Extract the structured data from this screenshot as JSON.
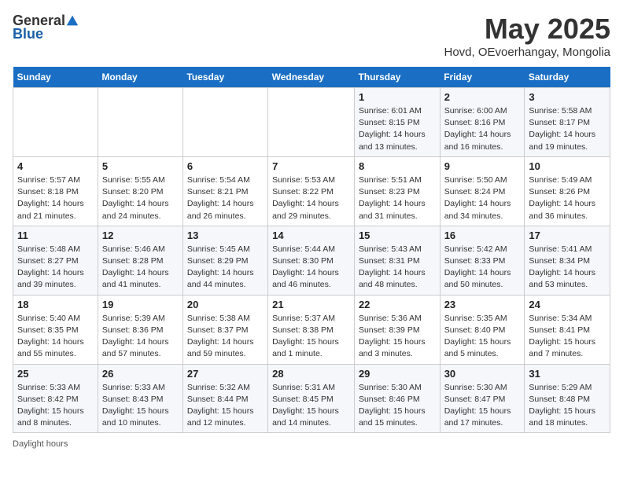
{
  "logo": {
    "general": "General",
    "blue": "Blue"
  },
  "title": {
    "month": "May 2025",
    "location": "Hovd, OEvoerhangay, Mongolia"
  },
  "weekdays": [
    "Sunday",
    "Monday",
    "Tuesday",
    "Wednesday",
    "Thursday",
    "Friday",
    "Saturday"
  ],
  "weeks": [
    [
      {
        "day": "",
        "info": ""
      },
      {
        "day": "",
        "info": ""
      },
      {
        "day": "",
        "info": ""
      },
      {
        "day": "",
        "info": ""
      },
      {
        "day": "1",
        "info": "Sunrise: 6:01 AM\nSunset: 8:15 PM\nDaylight: 14 hours\nand 13 minutes."
      },
      {
        "day": "2",
        "info": "Sunrise: 6:00 AM\nSunset: 8:16 PM\nDaylight: 14 hours\nand 16 minutes."
      },
      {
        "day": "3",
        "info": "Sunrise: 5:58 AM\nSunset: 8:17 PM\nDaylight: 14 hours\nand 19 minutes."
      }
    ],
    [
      {
        "day": "4",
        "info": "Sunrise: 5:57 AM\nSunset: 8:18 PM\nDaylight: 14 hours\nand 21 minutes."
      },
      {
        "day": "5",
        "info": "Sunrise: 5:55 AM\nSunset: 8:20 PM\nDaylight: 14 hours\nand 24 minutes."
      },
      {
        "day": "6",
        "info": "Sunrise: 5:54 AM\nSunset: 8:21 PM\nDaylight: 14 hours\nand 26 minutes."
      },
      {
        "day": "7",
        "info": "Sunrise: 5:53 AM\nSunset: 8:22 PM\nDaylight: 14 hours\nand 29 minutes."
      },
      {
        "day": "8",
        "info": "Sunrise: 5:51 AM\nSunset: 8:23 PM\nDaylight: 14 hours\nand 31 minutes."
      },
      {
        "day": "9",
        "info": "Sunrise: 5:50 AM\nSunset: 8:24 PM\nDaylight: 14 hours\nand 34 minutes."
      },
      {
        "day": "10",
        "info": "Sunrise: 5:49 AM\nSunset: 8:26 PM\nDaylight: 14 hours\nand 36 minutes."
      }
    ],
    [
      {
        "day": "11",
        "info": "Sunrise: 5:48 AM\nSunset: 8:27 PM\nDaylight: 14 hours\nand 39 minutes."
      },
      {
        "day": "12",
        "info": "Sunrise: 5:46 AM\nSunset: 8:28 PM\nDaylight: 14 hours\nand 41 minutes."
      },
      {
        "day": "13",
        "info": "Sunrise: 5:45 AM\nSunset: 8:29 PM\nDaylight: 14 hours\nand 44 minutes."
      },
      {
        "day": "14",
        "info": "Sunrise: 5:44 AM\nSunset: 8:30 PM\nDaylight: 14 hours\nand 46 minutes."
      },
      {
        "day": "15",
        "info": "Sunrise: 5:43 AM\nSunset: 8:31 PM\nDaylight: 14 hours\nand 48 minutes."
      },
      {
        "day": "16",
        "info": "Sunrise: 5:42 AM\nSunset: 8:33 PM\nDaylight: 14 hours\nand 50 minutes."
      },
      {
        "day": "17",
        "info": "Sunrise: 5:41 AM\nSunset: 8:34 PM\nDaylight: 14 hours\nand 53 minutes."
      }
    ],
    [
      {
        "day": "18",
        "info": "Sunrise: 5:40 AM\nSunset: 8:35 PM\nDaylight: 14 hours\nand 55 minutes."
      },
      {
        "day": "19",
        "info": "Sunrise: 5:39 AM\nSunset: 8:36 PM\nDaylight: 14 hours\nand 57 minutes."
      },
      {
        "day": "20",
        "info": "Sunrise: 5:38 AM\nSunset: 8:37 PM\nDaylight: 14 hours\nand 59 minutes."
      },
      {
        "day": "21",
        "info": "Sunrise: 5:37 AM\nSunset: 8:38 PM\nDaylight: 15 hours\nand 1 minute."
      },
      {
        "day": "22",
        "info": "Sunrise: 5:36 AM\nSunset: 8:39 PM\nDaylight: 15 hours\nand 3 minutes."
      },
      {
        "day": "23",
        "info": "Sunrise: 5:35 AM\nSunset: 8:40 PM\nDaylight: 15 hours\nand 5 minutes."
      },
      {
        "day": "24",
        "info": "Sunrise: 5:34 AM\nSunset: 8:41 PM\nDaylight: 15 hours\nand 7 minutes."
      }
    ],
    [
      {
        "day": "25",
        "info": "Sunrise: 5:33 AM\nSunset: 8:42 PM\nDaylight: 15 hours\nand 8 minutes."
      },
      {
        "day": "26",
        "info": "Sunrise: 5:33 AM\nSunset: 8:43 PM\nDaylight: 15 hours\nand 10 minutes."
      },
      {
        "day": "27",
        "info": "Sunrise: 5:32 AM\nSunset: 8:44 PM\nDaylight: 15 hours\nand 12 minutes."
      },
      {
        "day": "28",
        "info": "Sunrise: 5:31 AM\nSunset: 8:45 PM\nDaylight: 15 hours\nand 14 minutes."
      },
      {
        "day": "29",
        "info": "Sunrise: 5:30 AM\nSunset: 8:46 PM\nDaylight: 15 hours\nand 15 minutes."
      },
      {
        "day": "30",
        "info": "Sunrise: 5:30 AM\nSunset: 8:47 PM\nDaylight: 15 hours\nand 17 minutes."
      },
      {
        "day": "31",
        "info": "Sunrise: 5:29 AM\nSunset: 8:48 PM\nDaylight: 15 hours\nand 18 minutes."
      }
    ]
  ],
  "footer": {
    "daylight_label": "Daylight hours"
  }
}
